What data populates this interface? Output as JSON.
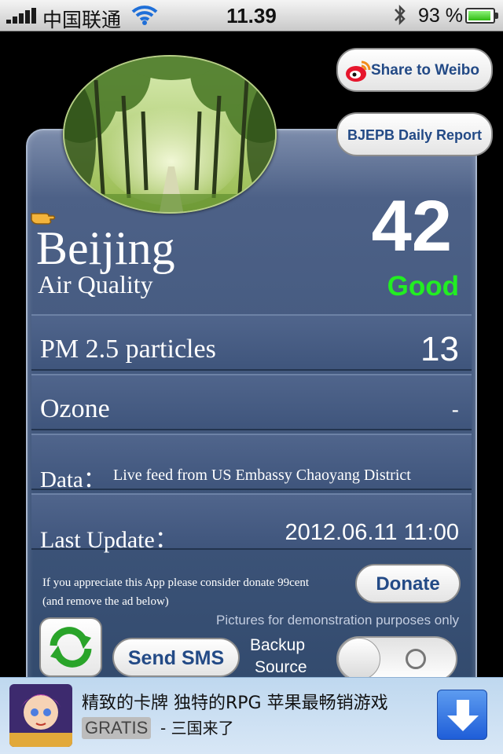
{
  "status_bar": {
    "carrier": "中国联通",
    "time": "11.39",
    "battery_text": "93 %",
    "battery_level": 0.93
  },
  "header": {
    "share_label": "Share to Weibo",
    "report_label": "BJEPB Daily Report"
  },
  "summary": {
    "city": "Beijing",
    "subtitle": "Air Quality",
    "aqi": "42",
    "status": "Good",
    "status_color": "#22ee22"
  },
  "rows": [
    {
      "label": "PM 2.5 particles",
      "value": "13"
    },
    {
      "label": "Ozone",
      "value": "-"
    },
    {
      "label": "Data：",
      "value": "Live feed from US Embassy Chaoyang District"
    },
    {
      "label": "Last Update：",
      "value": "2012.06.11 11:00"
    }
  ],
  "donate": {
    "line1": "If you appreciate this App please consider donate 99cent",
    "line2": "(and remove the ad below)",
    "button_label": "Donate"
  },
  "controls": {
    "demo_note": "Pictures for demonstration purposes only",
    "sms_label": "Send SMS",
    "backup_line1": "Backup",
    "backup_line2": "Source",
    "backup_toggle_on": false
  },
  "ad": {
    "title": "精致的卡牌 独特的RPG 苹果最畅销游戏",
    "tag": "GRATIS",
    "subtitle": "- 三国来了"
  },
  "icons": [
    "signal-bars-icon",
    "wifi-icon",
    "bluetooth-icon",
    "battery-icon",
    "weibo-icon",
    "pointing-hand-icon",
    "refresh-icon",
    "download-arrow-icon"
  ]
}
